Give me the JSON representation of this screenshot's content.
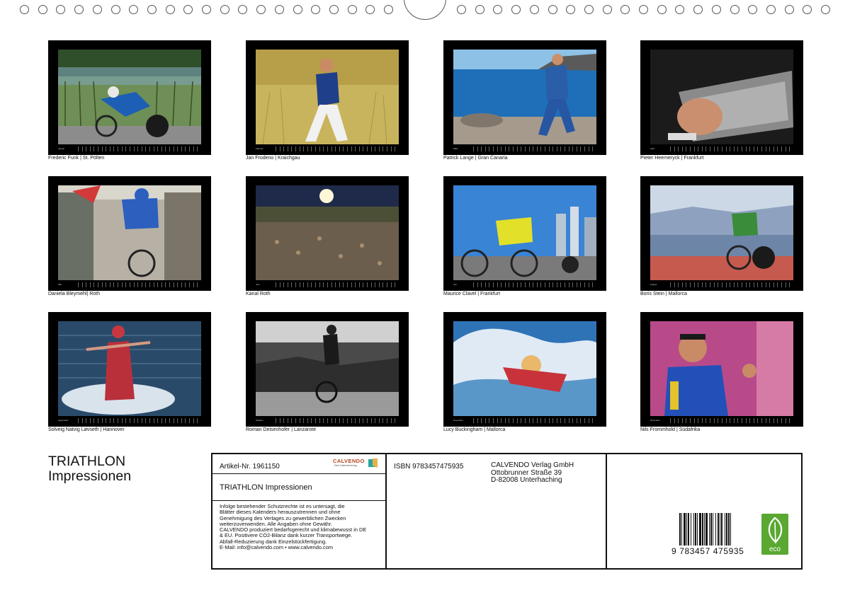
{
  "months": [
    {
      "caption": "Frederic Funk | St. Pölten",
      "month": "Januar"
    },
    {
      "caption": "Jan Frodeno | Kraichgau",
      "month": "Februar"
    },
    {
      "caption": "Patrick Lange | Gran Canaria",
      "month": "März"
    },
    {
      "caption": "Pieter Heemeryck | Frankfurt",
      "month": "April"
    },
    {
      "caption": "Daniela Bleymehl| Roth",
      "month": "Mai"
    },
    {
      "caption": "Kanal Roth",
      "month": "Juni"
    },
    {
      "caption": "Maurice Clavel | Frankfurt",
      "month": "Juli"
    },
    {
      "caption": "Boris Stein | Mallorca",
      "month": "August"
    },
    {
      "caption": "Solveig Natvig Løvseth | Hannover",
      "month": "September"
    },
    {
      "caption": "Roman Deisenhofer | Lanzarote",
      "month": "Oktober"
    },
    {
      "caption": "Lucy Buckingham | Mallorca",
      "month": "November"
    },
    {
      "caption": "Nils Frommhold | Südafrika",
      "month": "Dezember"
    }
  ],
  "title": {
    "line1": "TRIATHLON",
    "line2": "Impressionen"
  },
  "info": {
    "article": "Artikel-Nr. 1961150",
    "logo_word": "CALVENDO",
    "logo_sub": "Dein Kalenderverlag",
    "calendar_title": "TRIATHLON Impressionen",
    "legal_lines": [
      "Infolge bestehender Schutzrechte ist es untersagt, die",
      "Blätter dieses Kalenders herauszutrennen und ohne",
      "Genehmigung des Verlages zu gewerblichen Zwecken",
      "weiterzuverwenden. Alle Angaben ohne Gewähr.",
      "CALVENDO produziert bedarfsgerecht und klimabewusst in DE",
      "& EU. Positivere CO2-Bilanz dank kurzer Transportwege.",
      "Abfall-Reduzierung dank Einzelstückfertigung.",
      "E-Mail: info@calvendo.com • www.calvendo.com"
    ],
    "isbn": "ISBN 9783457475935",
    "publisher": [
      "CALVENDO Verlag GmbH",
      "Ottobrunner Straße 39",
      "D-82008 Unterhaching"
    ],
    "barcode_digits": "9 783457 475935",
    "eco_label": "eco"
  },
  "colors": {
    "logo": "#b4451f",
    "eco": "#5aa832"
  }
}
